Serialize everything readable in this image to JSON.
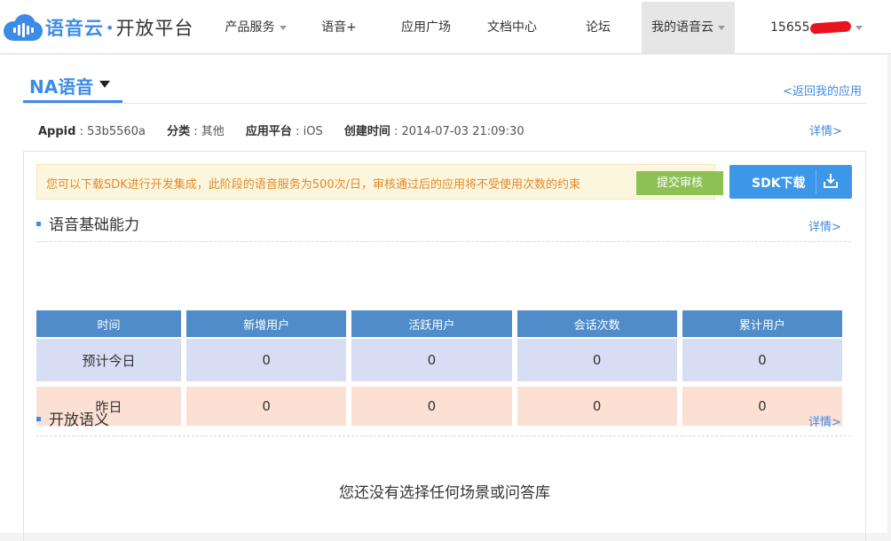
{
  "header": {
    "logo_brand": "语音云",
    "logo_dot": "•",
    "logo_title": "开放平台",
    "nav": [
      {
        "label": "产品服务",
        "dropdown": true
      },
      {
        "label": "语音+",
        "dropdown": false
      },
      {
        "label": "应用广场",
        "dropdown": false
      },
      {
        "label": "文档中心",
        "dropdown": false
      },
      {
        "label": "论坛",
        "dropdown": false
      },
      {
        "label": "我的语音云",
        "dropdown": true,
        "active": true
      }
    ],
    "user_partial": "15655"
  },
  "app": {
    "name": "NA语音",
    "back_link": "<返回我的应用",
    "meta": {
      "appid_label": "Appid",
      "appid_value": "53b5560a",
      "category_label": "分类",
      "category_value": "其他",
      "platform_label": "应用平台",
      "platform_value": "iOS",
      "created_label": "创建时间",
      "created_value": "2014-07-03 21:09:30"
    },
    "detail_link": "详情>"
  },
  "notice": {
    "text": "您可以下载SDK进行开发集成，此阶段的语音服务为500次/日，审核通过后的应用将不受使用次数的约束",
    "audit_button": "提交审核",
    "sdk_button": "SDK下载"
  },
  "basic": {
    "title": "语音基础能力",
    "detail_link": "详情>",
    "columns": [
      "时间",
      "新增用户",
      "活跃用户",
      "会话次数",
      "累计用户"
    ],
    "rows": [
      [
        "预计今日",
        "0",
        "0",
        "0",
        "0"
      ],
      [
        "昨日",
        "0",
        "0",
        "0",
        "0"
      ]
    ]
  },
  "semantic": {
    "title": "开放语义",
    "detail_link": "详情>",
    "empty_text": "您还没有选择任何场景或问答库"
  },
  "colors": {
    "brand": "#3d8be6",
    "table_header": "#4f8cc9",
    "row_today": "#d7ddf2",
    "row_yesterday": "#fde0d4",
    "audit_button": "#8dc154",
    "notice_text": "#e08a2a"
  }
}
